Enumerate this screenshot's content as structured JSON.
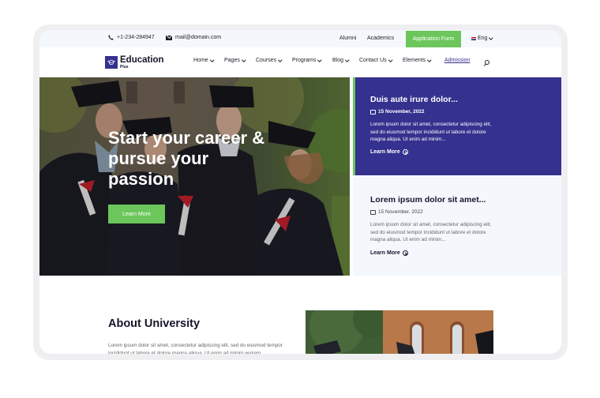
{
  "topbar": {
    "phone": "+1-234-284947",
    "email": "mail@domain.com",
    "links": [
      "Alumni",
      "Academics"
    ],
    "apply_button": "Application Form",
    "language": "Eng"
  },
  "nav": {
    "logo_title": "Education",
    "logo_subtitle": "Plus",
    "items": [
      {
        "label": "Home"
      },
      {
        "label": "Pages"
      },
      {
        "label": "Courses"
      },
      {
        "label": "Programs"
      },
      {
        "label": "Blog"
      },
      {
        "label": "Contact Us"
      },
      {
        "label": "Elements"
      }
    ],
    "admission": "Admission"
  },
  "hero": {
    "title": "Start your career & pursue your passion",
    "button": "Learn More"
  },
  "posts": [
    {
      "title": "Duis aute irure dolor...",
      "date": "15 November, 2022",
      "excerpt": "Lorem ipsum dolor sit amet, consectetur adipiscing elit, sed do eiusmod tempor incididunt ut labore et dolore magna aliqua. Ut enim ad minim...",
      "link": "Learn More"
    },
    {
      "title": "Lorem ipsum dolor sit amet...",
      "date": "15 November, 2022",
      "excerpt": "Lorem ipsum dolor sit amet, consectetur adipiscing elit, sed do eiusmod tempor incididunt ut labore et dolore magna aliqua. Ut enim ad minim...",
      "link": "Learn More"
    }
  ],
  "about": {
    "title": "About University",
    "text": "Lorem ipsum dolor sit amet, consectetur adipiscing elit, sed do eiusmod tempor incididunt ut labore et dolore magna aliqua. Ut enim ad minim veniam"
  },
  "colors": {
    "brand": "#35318f",
    "accent": "#6cc65b",
    "topbar_bg": "#f4f8fd"
  }
}
